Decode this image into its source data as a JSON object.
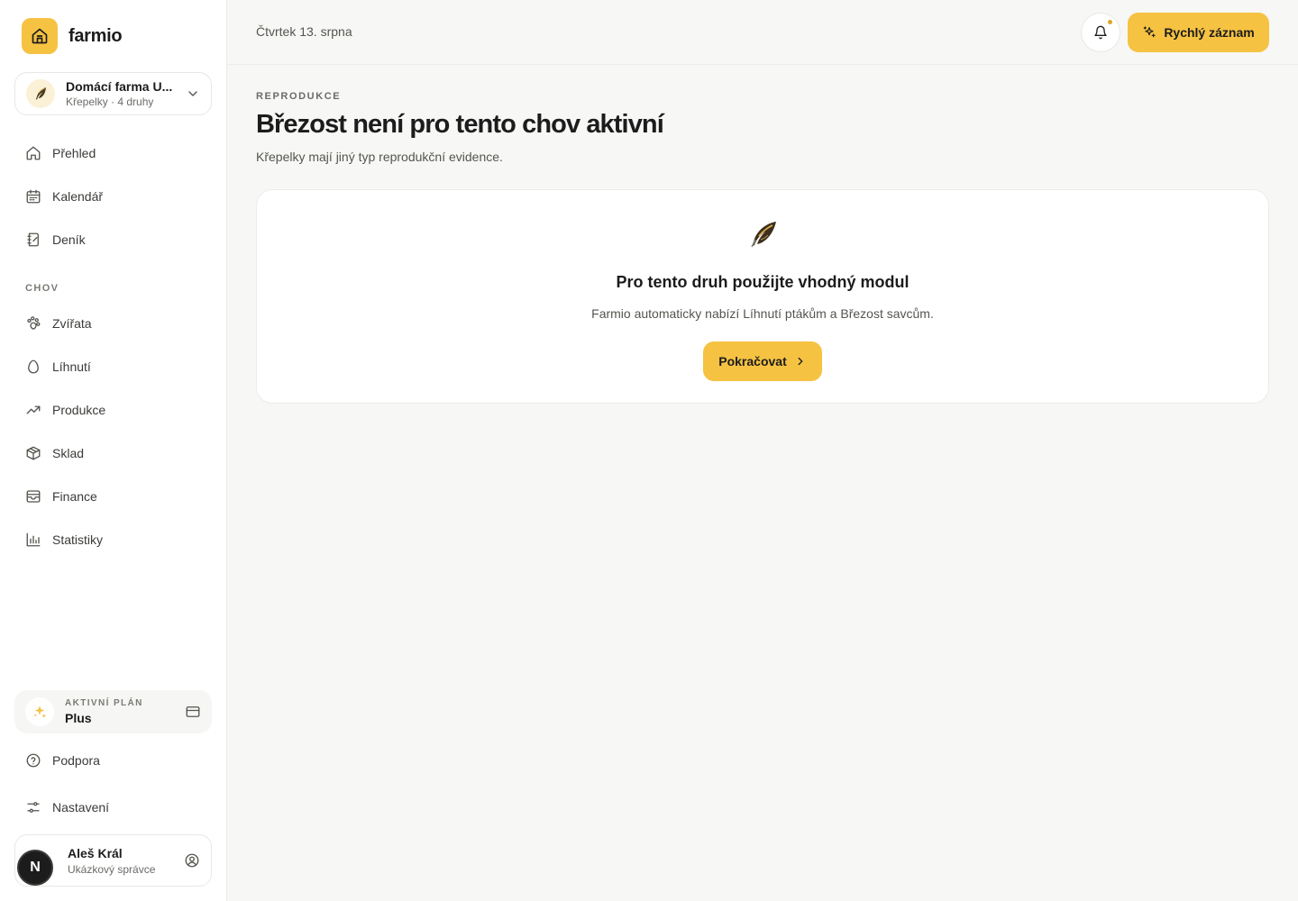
{
  "app": {
    "name": "farmio"
  },
  "farm": {
    "name": "Domácí farma U...",
    "subtitle": "Křepelky · 4 druhy",
    "avatar_icon": "feather-icon"
  },
  "nav": {
    "main": [
      {
        "label": "Přehled",
        "icon": "home-icon"
      },
      {
        "label": "Kalendář",
        "icon": "calendar-icon"
      },
      {
        "label": "Deník",
        "icon": "notebook-icon"
      }
    ],
    "section_label": "CHOV",
    "chov": [
      {
        "label": "Zvířata",
        "icon": "paw-icon"
      },
      {
        "label": "Líhnutí",
        "icon": "egg-icon"
      },
      {
        "label": "Produkce",
        "icon": "trending-up-icon"
      },
      {
        "label": "Sklad",
        "icon": "box-icon"
      },
      {
        "label": "Finance",
        "icon": "wallet-icon"
      },
      {
        "label": "Statistiky",
        "icon": "bar-chart-icon"
      }
    ],
    "bottom": [
      {
        "label": "Podpora",
        "icon": "help-circle-icon"
      },
      {
        "label": "Nastavení",
        "icon": "sliders-icon"
      }
    ]
  },
  "plan": {
    "caption": "AKTIVNÍ PLÁN",
    "name": "Plus"
  },
  "user": {
    "initial": "N",
    "name": "Aleš Král",
    "role": "Ukázkový správce"
  },
  "header": {
    "date": "Čtvrtek 13. srpna",
    "quick_label": "Rychlý záznam",
    "accent": "#f5c242"
  },
  "page": {
    "eyebrow": "REPRODUKCE",
    "title": "Březost není pro tento chov aktivní",
    "subtitle": "Křepelky mají jiný typ reprodukční evidence."
  },
  "card": {
    "title": "Pro tento druh použijte vhodný modul",
    "text": "Farmio automaticky nabízí Líhnutí ptákům a Březost savcům.",
    "button_label": "Pokračovat"
  }
}
